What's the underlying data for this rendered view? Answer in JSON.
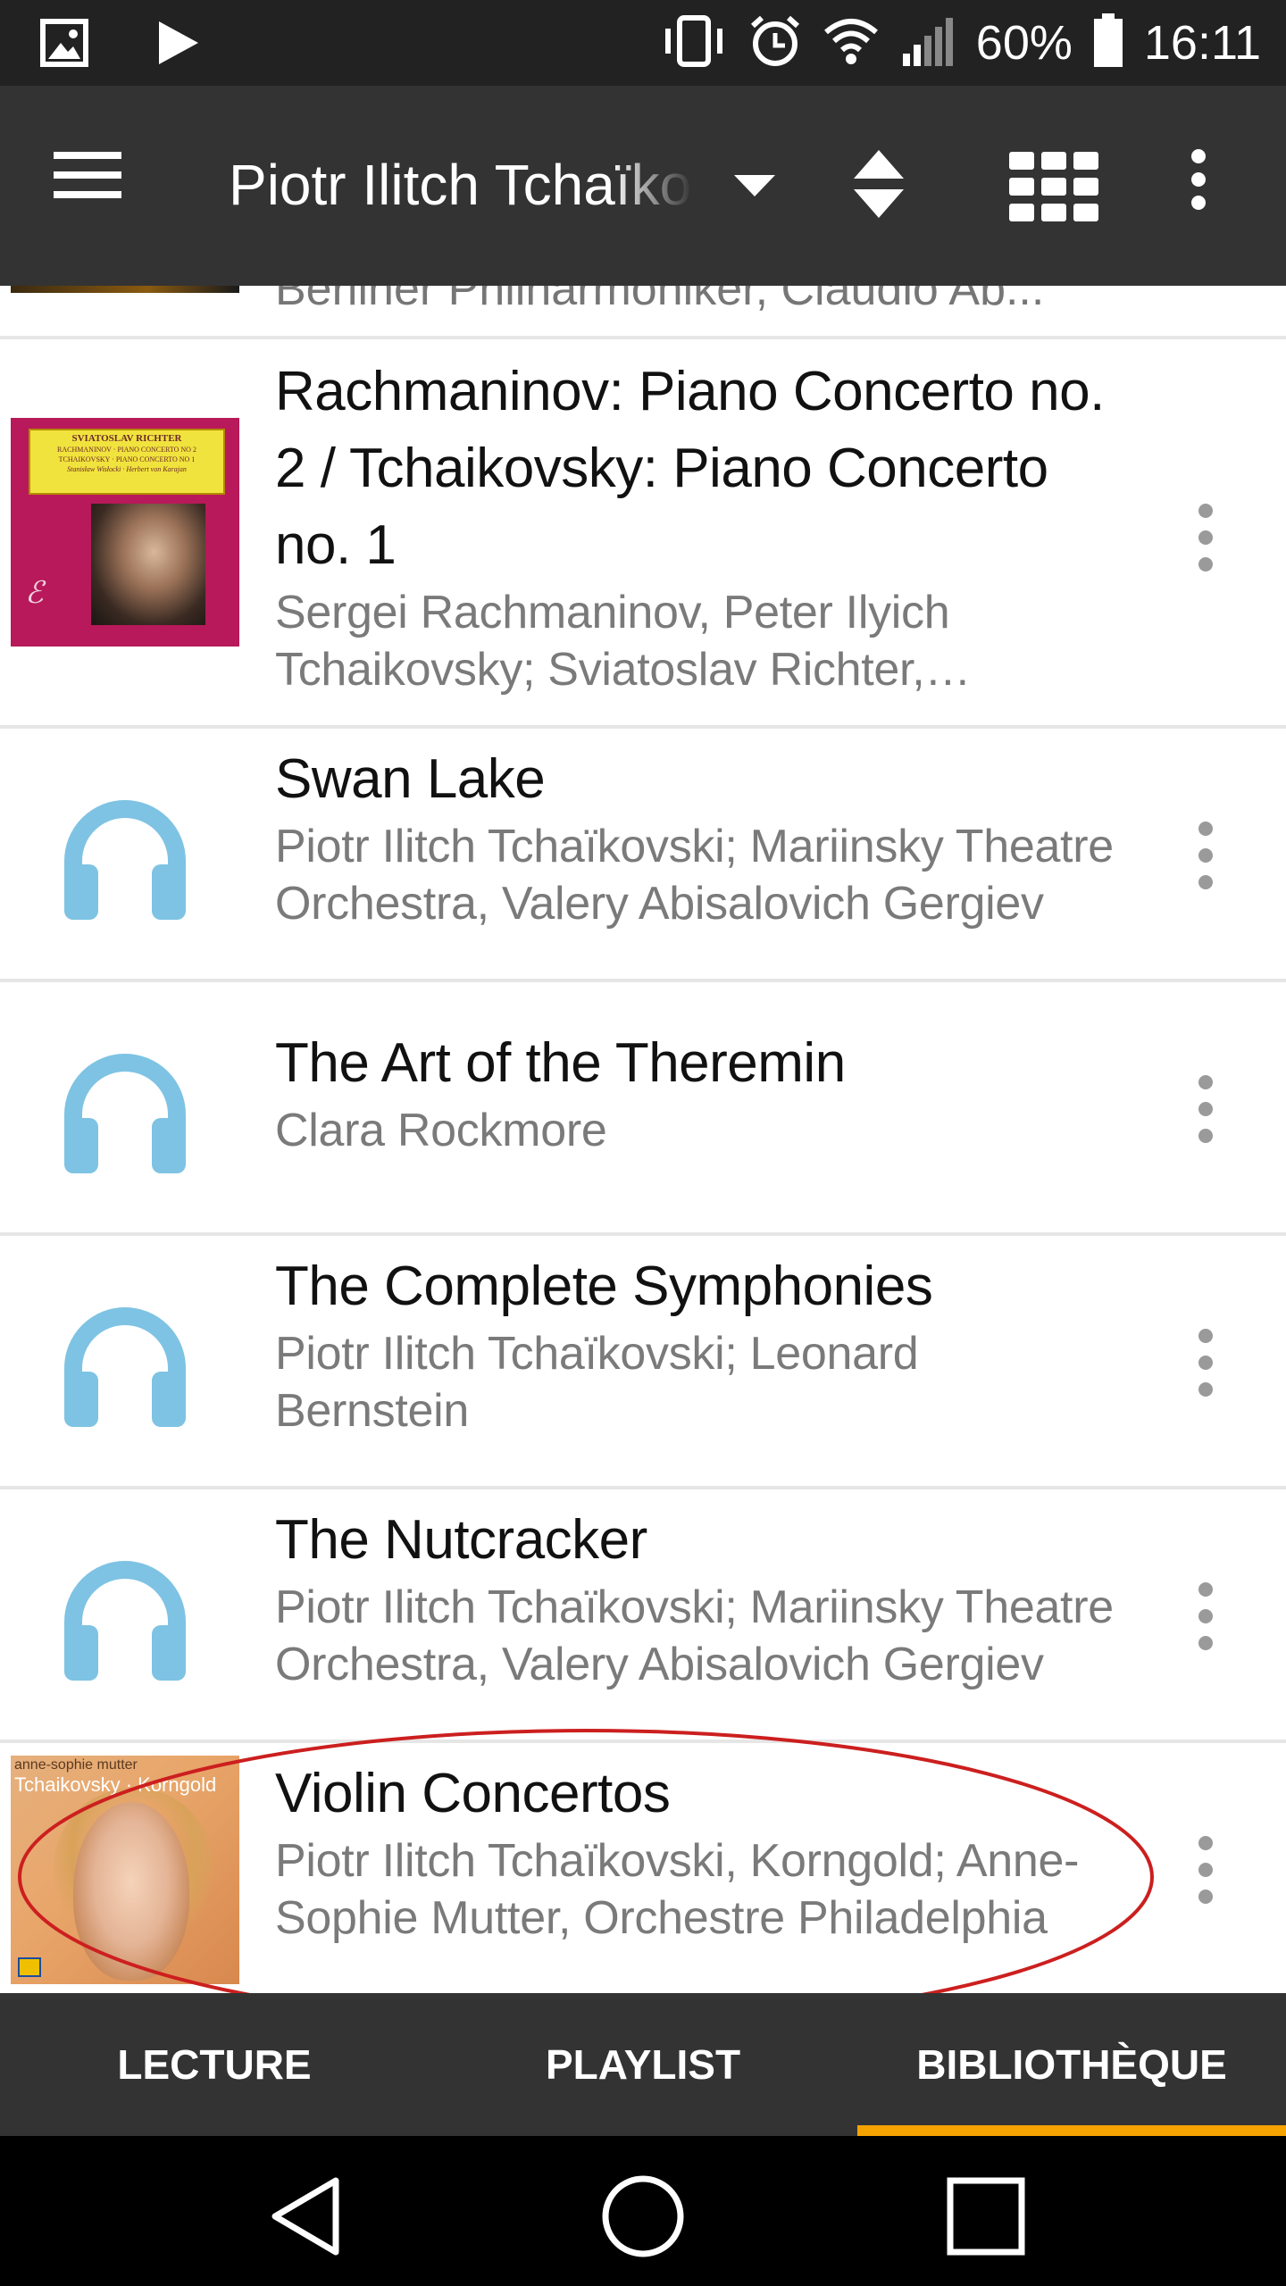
{
  "status_bar": {
    "battery": "60%",
    "time": "16:11",
    "icons": [
      "image-icon",
      "play-icon",
      "vibrate-icon",
      "alarm-icon",
      "wifi-icon",
      "signal-icon",
      "battery-icon"
    ]
  },
  "app_bar": {
    "title": "Piotr Ilitch Tchaïkovski",
    "icons": [
      "menu-icon",
      "dropdown-icon",
      "sort-icon",
      "grid-icon",
      "overflow-menu-icon"
    ]
  },
  "list": {
    "partial_item_subtitle": "Berliner Philharmoniker, Claudio Ab...",
    "items": [
      {
        "title": "Rachmaninov: Piano Concerto no. 2 / Tchaikovsky: Piano Concerto no. 1",
        "subtitle": "Sergei Rachmaninov, Peter Ilyich Tchaikovsky; Sviatoslav Richter, Stanislaw Wislocki",
        "art": "album-cover",
        "art_text": [
          "SVIATOSLAV RICHTER",
          "RACHMANINOV · PIANO CONCERTO NO 2",
          "TCHAIKOVSKY · PIANO CONCERTO NO 1",
          "Stanisław Wisłocki · Herbert von Karajan"
        ]
      },
      {
        "title": "Swan Lake",
        "subtitle": "Piotr Ilitch Tchaïkovski; Mariinsky Theatre Orchestra, Valery Abisalovich Gergiev",
        "art": "headphones-icon"
      },
      {
        "title": "The Art of the Theremin",
        "subtitle": "Clara Rockmore",
        "art": "headphones-icon"
      },
      {
        "title": "The Complete Symphonies",
        "subtitle": "Piotr Ilitch Tchaïkovski; Leonard Bernstein",
        "art": "headphones-icon"
      },
      {
        "title": "The Nutcracker",
        "subtitle": "Piotr Ilitch Tchaïkovski; Mariinsky Theatre Orchestra, Valery Abisalovich Gergiev",
        "art": "headphones-icon"
      },
      {
        "title": "Violin Concertos",
        "subtitle": "Piotr Ilitch Tchaïkovski, Korngold; Anne-Sophie Mutter, Orchestre Philadelphia",
        "art": "album-cover",
        "art_text": [
          "anne-sophie mutter",
          "Tchaikovsky · Korngold"
        ]
      }
    ]
  },
  "tabs": {
    "items": [
      "LECTURE",
      "PLAYLIST",
      "BIBLIOTHÈQUE"
    ],
    "active": "BIBLIOTHÈQUE"
  },
  "colors": {
    "app_bar": "#333333",
    "status_bar": "#222222",
    "accent": "#f5a300",
    "headphones": "#7ec3e3",
    "annotation": "#cc1f1f"
  }
}
